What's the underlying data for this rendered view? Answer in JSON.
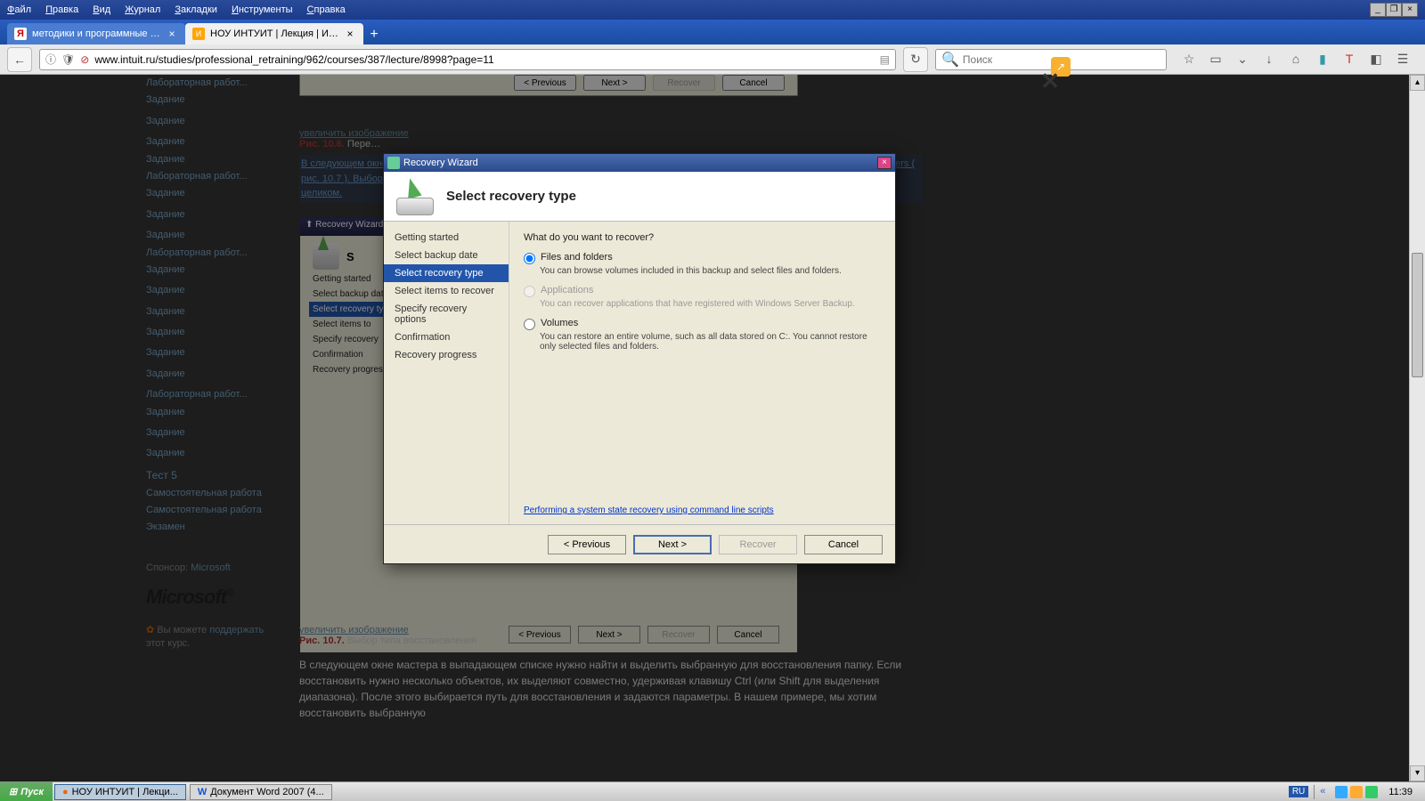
{
  "menubar": [
    "Файл",
    "Правка",
    "Вид",
    "Журнал",
    "Закладки",
    "Инструменты",
    "Справка"
  ],
  "tabs": [
    {
      "title": "методики и программные пр...",
      "active": false,
      "favicon": "Y"
    },
    {
      "title": "НОУ ИНТУИТ | Лекция | Иде...",
      "active": true,
      "favicon": "I"
    }
  ],
  "url": "www.intuit.ru/studies/professional_retraining/962/courses/387/lecture/8998?page=11",
  "search_placeholder": "Поиск",
  "sidebar": {
    "items": [
      "Лабораторная работ...",
      "Задание",
      "",
      "Задание",
      "",
      "Задание",
      "Задание",
      "Лабораторная работ...",
      "Задание",
      "",
      "Задание",
      "",
      "Задание",
      "Лабораторная работ...",
      "Задание",
      "",
      "Задание",
      "",
      "Задание",
      "",
      "Задание",
      "",
      "Задание",
      "",
      "Задание",
      "",
      "Лабораторная работ...",
      "Задание",
      "",
      "Задание",
      "",
      "Задание"
    ],
    "test": "Тест 5",
    "self1": "Самостоятельная работа",
    "self2": "Самостоятельная работа",
    "exam": "Экзамен",
    "sponsor_label": "Спонсор:",
    "sponsor": "Microsoft",
    "support1": "Вы можете",
    "support2": "поддержать",
    "support3": "этот курс."
  },
  "article": {
    "enlarge1": "увеличить изображение",
    "fig6_bold": "Рис. 10.6.",
    "fig6_rest": "Пере…",
    "bluepara": "В следующем окне мастера нужно выбрать дату и время восстановления. Затем выбирается тип восстановления — Files and folders ( рис. 10.7 ). Выбор Volumes означает восстановление всего тома — в данный момент нет необходимости восстанавливать том целиком.",
    "enlarge2": "увеличить изображение",
    "fig7_bold": "Рис. 10.7.",
    "fig7_rest": "Выбор типа восстановления",
    "para": "В следующем окне мастера в выпадающем списке нужно найти и выделить выбранную для восстановления папку. Если восстановить нужно несколько объектов, их выделяют совместно, удерживая клавишу Ctrl (или Shift для выделения диапазона). После этого выбирается путь для восстановления и задаются параметры. В нашем примере, мы хотим восстановить выбранную"
  },
  "modal": {
    "title": "Recovery Wizard",
    "heading": "Select recovery type",
    "steps": [
      "Getting started",
      "Select backup date",
      "Select recovery type",
      "Select items to recover",
      "Specify recovery options",
      "Confirmation",
      "Recovery progress"
    ],
    "active_step": 2,
    "question": "What do you want to recover?",
    "opt1_label": "Files and folders",
    "opt1_hint": "You can browse volumes included in this backup and select files and folders.",
    "opt2_label": "Applications",
    "opt2_hint": "You can recover applications that have registered with Windows Server Backup.",
    "opt3_label": "Volumes",
    "opt3_hint": "You can restore an entire volume, such as all data stored on C:. You cannot restore only selected files and folders.",
    "link": "Performing a system state recovery using command line scripts",
    "btn_prev": "< Previous",
    "btn_next": "Next >",
    "btn_recover": "Recover",
    "btn_cancel": "Cancel"
  },
  "small_wizard": {
    "title": "Recovery Wizard",
    "heading_letter": "S",
    "steps": [
      "Getting started",
      "Select backup date",
      "Select recovery type",
      "Select items to",
      "Specify recovery",
      "Confirmation",
      "Recovery progress"
    ],
    "btns": [
      "< Previous",
      "Next >",
      "Recover",
      "Cancel"
    ]
  },
  "taskbar": {
    "start": "Пуск",
    "tasks": [
      {
        "title": "НОУ ИНТУИТ | Лекци...",
        "active": true
      },
      {
        "title": "Документ Word 2007 (4...",
        "active": false
      }
    ],
    "lang": "RU",
    "clock": "11:39"
  }
}
